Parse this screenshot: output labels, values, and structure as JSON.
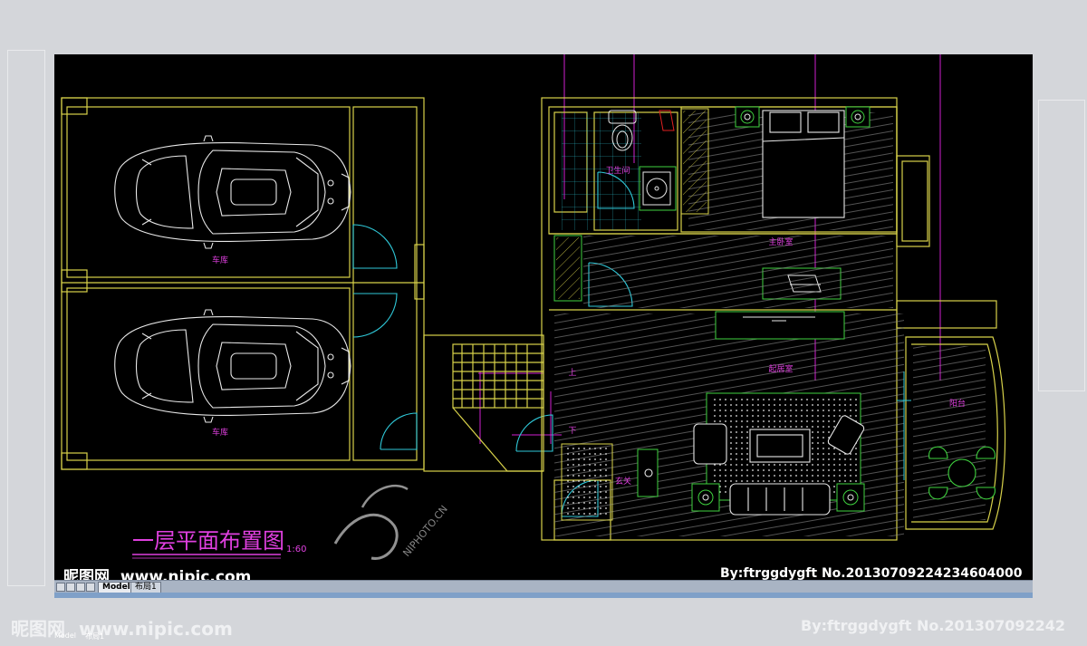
{
  "drawing": {
    "title": "一层平面布置图",
    "scale": "1:60",
    "rooms": {
      "garage_1": "车库",
      "garage_2": "车库",
      "bathroom": "卫生间",
      "master_bedroom": "主卧室",
      "living_room": "起居室",
      "balcony": "阳台",
      "entrance": "玄关",
      "stair_up": "上",
      "stair_down": "下"
    }
  },
  "tabs": {
    "model": "Model",
    "layout": "布局1"
  },
  "watermark": {
    "site_cn": "昵图网",
    "site_url": "www.nipic.com",
    "credit": "By:ftrggdygft  No.20130709224234604000",
    "ghost_credit": "By:ftrggdygft  No.201307092242",
    "stamp": "NIPHOTO.CN"
  },
  "colors": {
    "wall": "#d8d24a",
    "furniture": "#e8e8e8",
    "green": "#3fd23f",
    "cyan": "#2fc8d8",
    "magenta": "#d020d0",
    "label": "#e040e0",
    "red": "#e02020"
  }
}
